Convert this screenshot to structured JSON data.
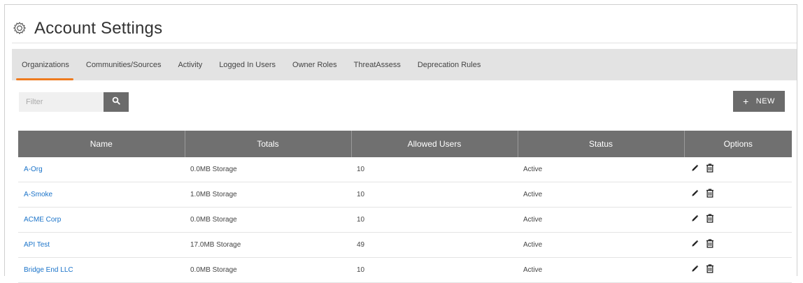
{
  "page": {
    "title": "Account Settings"
  },
  "tabs": [
    {
      "label": "Organizations",
      "active": true
    },
    {
      "label": "Communities/Sources",
      "active": false
    },
    {
      "label": "Activity",
      "active": false
    },
    {
      "label": "Logged In Users",
      "active": false
    },
    {
      "label": "Owner Roles",
      "active": false
    },
    {
      "label": "ThreatAssess",
      "active": false
    },
    {
      "label": "Deprecation Rules",
      "active": false
    }
  ],
  "filter": {
    "placeholder": "Filter",
    "value": ""
  },
  "actions": {
    "new_label": "NEW"
  },
  "table": {
    "columns": [
      "Name",
      "Totals",
      "Allowed Users",
      "Status",
      "Options"
    ],
    "rows": [
      {
        "name": "A-Org",
        "totals": "0.0MB Storage",
        "allowed_users": "10",
        "status": "Active"
      },
      {
        "name": "A-Smoke",
        "totals": "1.0MB Storage",
        "allowed_users": "10",
        "status": "Active"
      },
      {
        "name": "ACME Corp",
        "totals": "0.0MB Storage",
        "allowed_users": "10",
        "status": "Active"
      },
      {
        "name": "API Test",
        "totals": "17.0MB Storage",
        "allowed_users": "49",
        "status": "Active"
      },
      {
        "name": "Bridge End LLC",
        "totals": "0.0MB Storage",
        "allowed_users": "10",
        "status": "Active"
      }
    ]
  },
  "icons": {
    "header": "gear-icon",
    "filter_button": "search-icon",
    "row_edit": "pencil-icon",
    "row_delete": "trash-icon"
  },
  "colors": {
    "accent": "#ee7b1f",
    "link": "#1a73c9",
    "table_header": "#707070",
    "tab_bar": "#e3e3e3"
  }
}
